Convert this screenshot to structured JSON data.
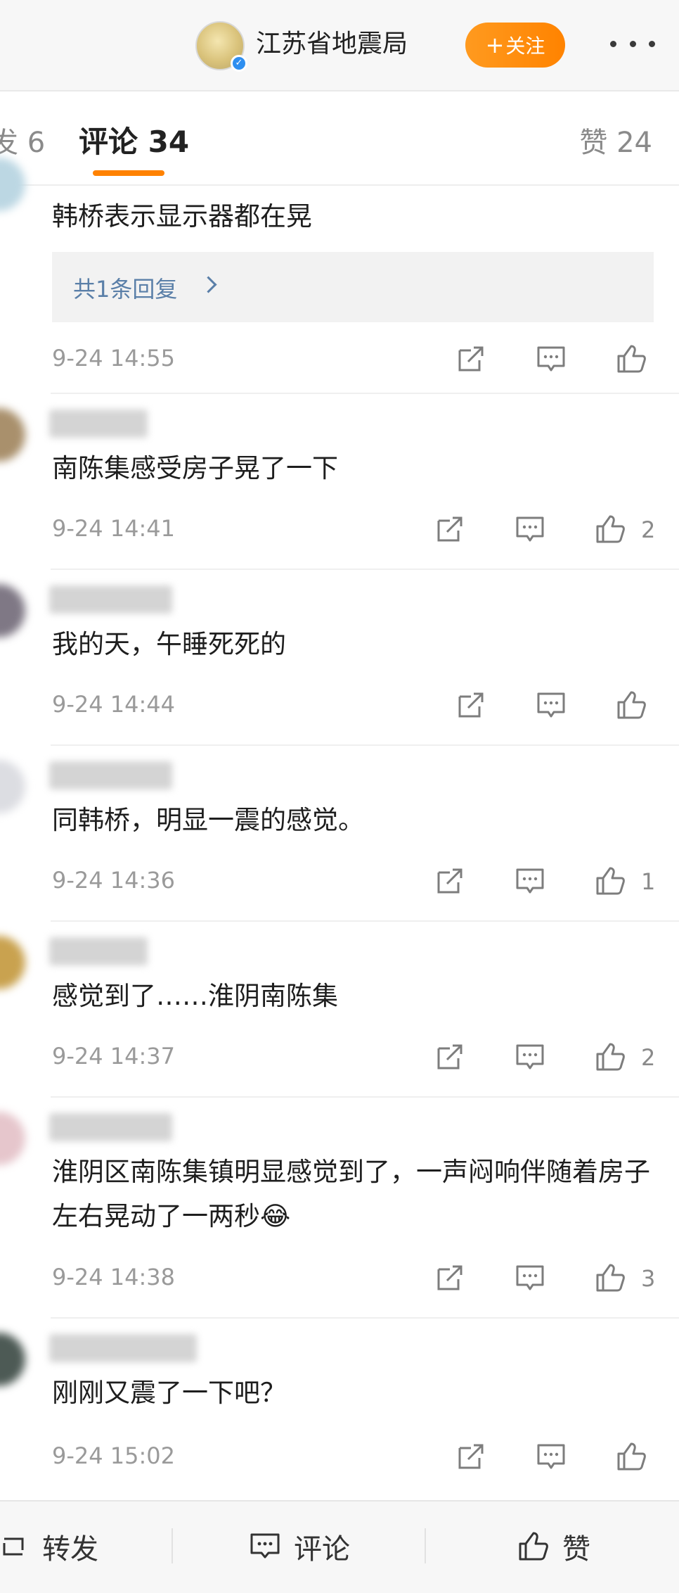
{
  "header": {
    "account_name": "江苏省地震局",
    "follow_label": "关注",
    "follow_plus": "+"
  },
  "tabs": {
    "repost_label": "发 6",
    "comments_label": "评论 34",
    "likes_label": "赞 24"
  },
  "comments": [
    {
      "text": "韩桥表示显示器都在晃",
      "reply_label": "共1条回复",
      "time": "9-24 14:55",
      "likes": ""
    },
    {
      "text": "南陈集感受房子晃了一下",
      "time": "9-24 14:41",
      "likes": "2"
    },
    {
      "text": "我的天，午睡死死的",
      "time": "9-24 14:44",
      "likes": ""
    },
    {
      "text": "同韩桥，明显一震的感觉。",
      "time": "9-24 14:36",
      "likes": "1"
    },
    {
      "text": "感觉到了……淮阴南陈集",
      "time": "9-24 14:37",
      "likes": "2"
    },
    {
      "text": "淮阴区南陈集镇明显感觉到了，一声闷响伴随着房子左右晃动了一两秒😂",
      "time": "9-24 14:38",
      "likes": "3"
    },
    {
      "text": "刚刚又震了一下吧？",
      "time": "9-24 15:02",
      "likes": ""
    }
  ],
  "bottom_bar": {
    "repost_label": "转发",
    "comment_label": "评论",
    "like_label": "赞"
  },
  "colors": {
    "accent": "#ff8200",
    "link": "#5a7fa8",
    "verified": "#2f8ff0"
  },
  "icons": [
    "verified-icon",
    "more-icon",
    "share-icon",
    "comment-icon",
    "like-icon",
    "repost-icon"
  ]
}
